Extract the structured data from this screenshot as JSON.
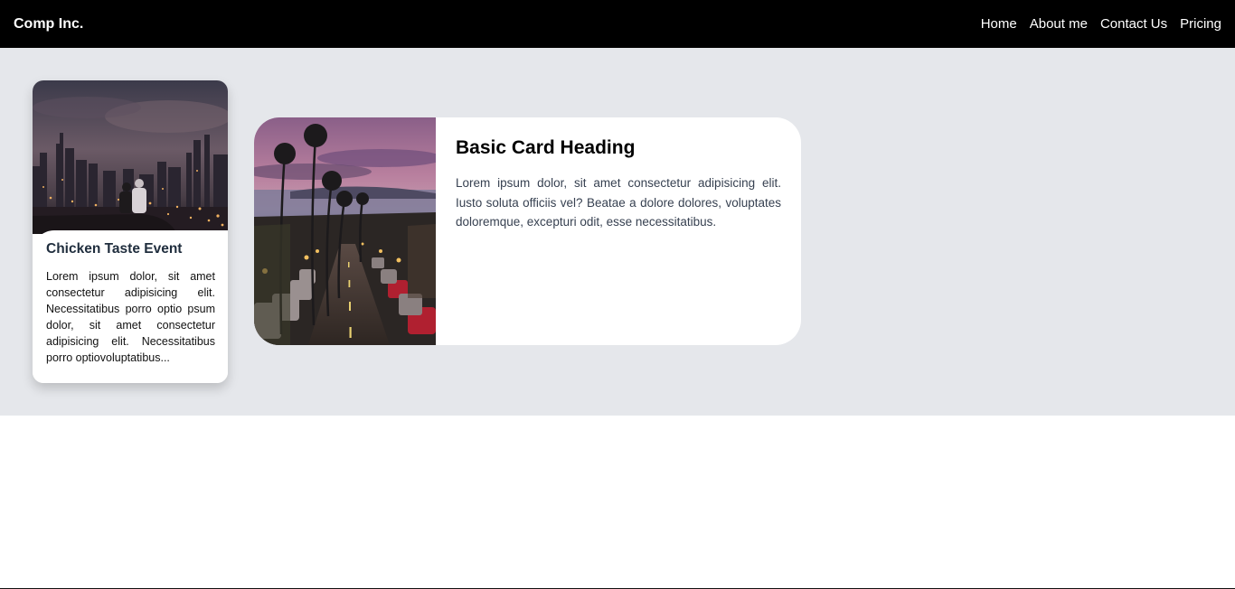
{
  "navbar": {
    "brand": "Comp Inc.",
    "links": [
      "Home",
      "About me",
      "Contact Us",
      "Pricing"
    ]
  },
  "card_event": {
    "title": "Chicken Taste Event",
    "text": "Lorem ipsum dolor, sit amet consectetur adipisicing elit. Necessitatibus porro optio psum dolor, sit amet consectetur adipisicing elit. Necessitatibus porro optiovoluptatibus..."
  },
  "card_basic": {
    "title": "Basic Card Heading",
    "text": "Lorem ipsum dolor, sit amet consectetur adipisicing elit. Iusto soluta officiis vel? Beatae a dolore dolores, voluptates doloremque, excepturi odit, esse necessitatibus."
  },
  "colors": {
    "navbar_bg": "#000000",
    "main_bg": "#e5e7eb",
    "card_bg": "#ffffff"
  }
}
